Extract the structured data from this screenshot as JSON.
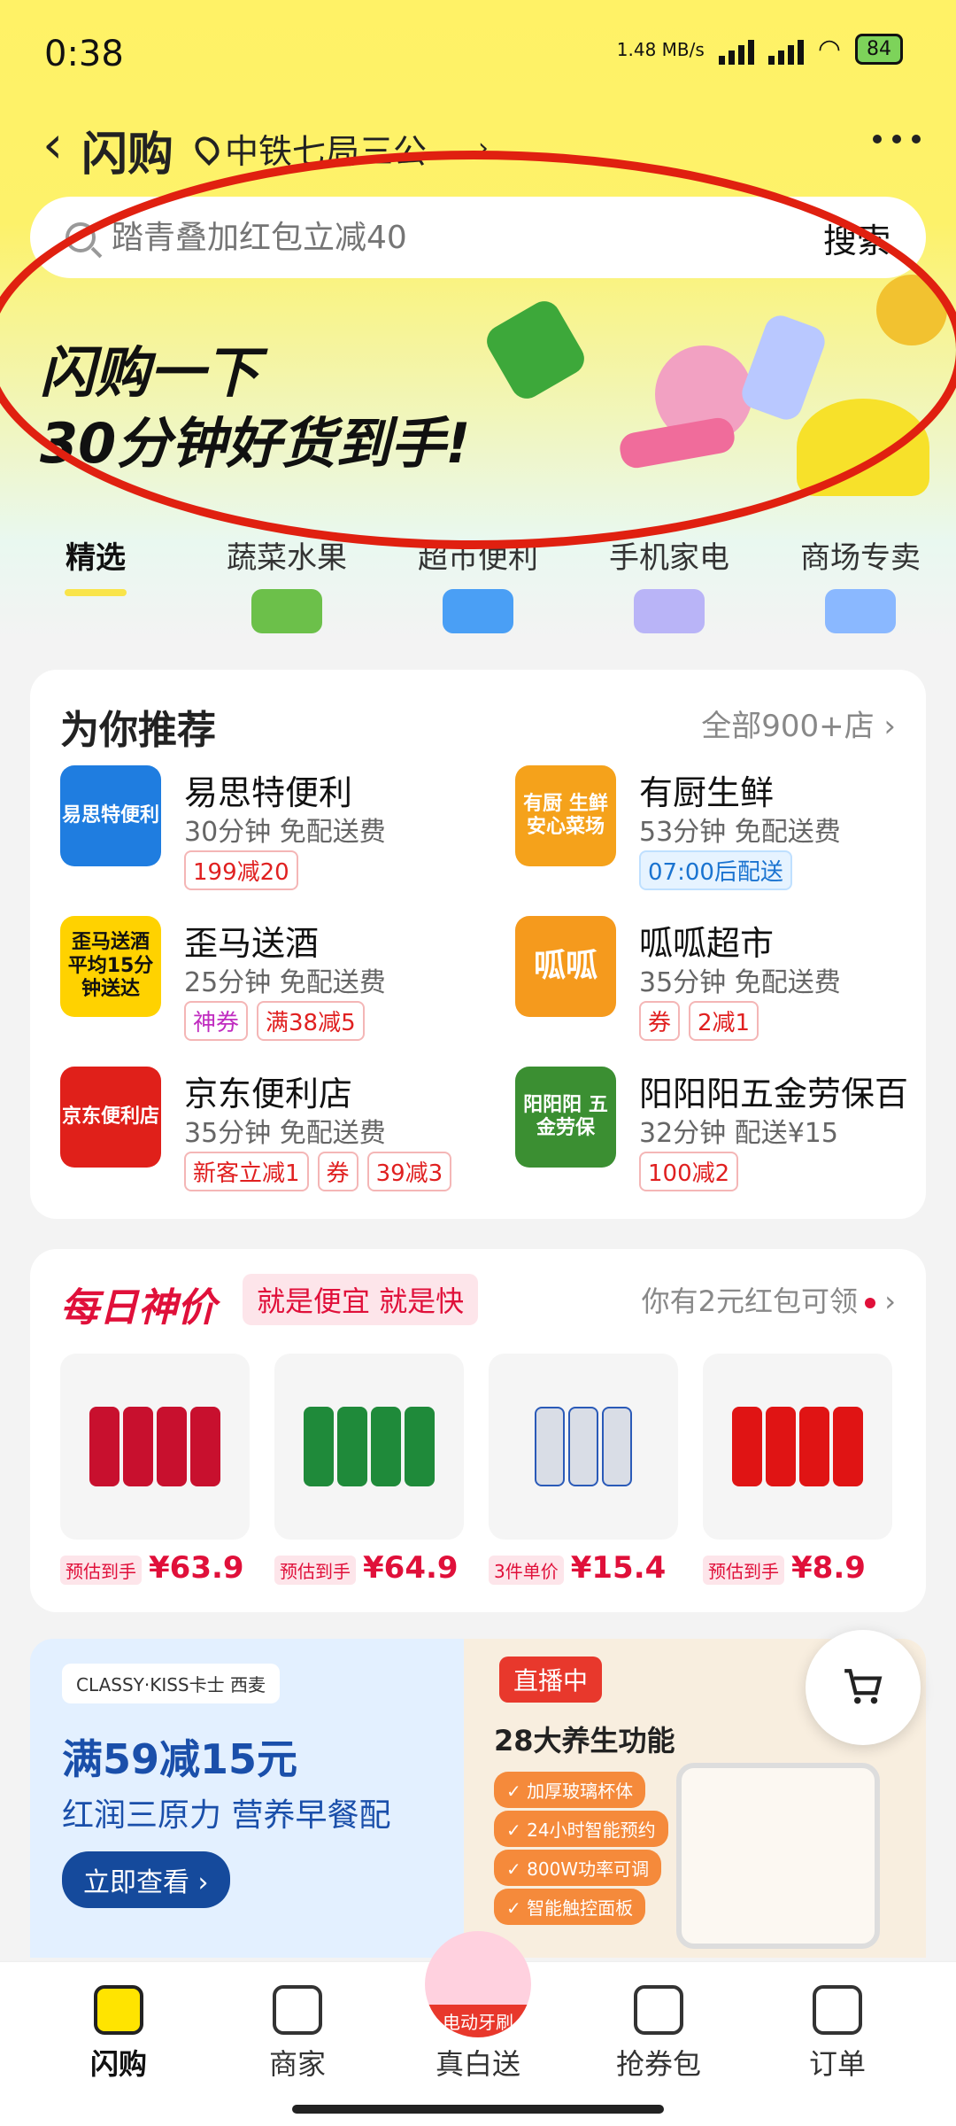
{
  "status": {
    "time": "0:38",
    "net_speed": "1.48 MB/s",
    "battery": "84"
  },
  "nav": {
    "title": "闪购",
    "location": "中铁七局三公"
  },
  "search": {
    "placeholder": "踏青叠加红包立减40",
    "button": "搜索"
  },
  "banner": {
    "line1": "闪购一下",
    "line2": "30分钟好货到手!"
  },
  "tabs": [
    "精选",
    "蔬菜水果",
    "超市便利",
    "手机家电",
    "商场专卖"
  ],
  "recommend": {
    "title": "为你推荐",
    "all": "全部900+店 ›",
    "stores": [
      {
        "name": "易思特便利",
        "info": "30分钟 免配送费",
        "tags": [
          "199减20"
        ],
        "logo_text": "易思特便利",
        "logo_color": "#1f7de0"
      },
      {
        "name": "有厨生鲜",
        "info": "53分钟 免配送费",
        "tags": [
          "07:00后配送"
        ],
        "logo_text": "有厨 生鲜 安心菜场",
        "logo_color": "#f5a21b"
      },
      {
        "name": "歪马送酒",
        "info": "25分钟 免配送费",
        "tags": [
          "神券",
          "满38减5"
        ],
        "logo_text": "歪马送酒 平均15分钟送达",
        "logo_color": "#ffd200"
      },
      {
        "name": "呱呱超市",
        "info": "35分钟 免配送费",
        "tags": [
          "券",
          "2减1"
        ],
        "logo_text": "呱呱",
        "logo_color": "#f59a1d"
      },
      {
        "name": "京东便利店",
        "info": "35分钟 免配送费",
        "tags": [
          "新客立减1",
          "券",
          "39减3"
        ],
        "logo_text": "京东便利店",
        "logo_color": "#e0201a"
      },
      {
        "name": "阳阳阳五金劳保百",
        "info": "32分钟 配送¥15",
        "tags": [
          "100减2"
        ],
        "logo_text": "阳阳阳 五金劳保",
        "logo_color": "#3b8f32"
      }
    ]
  },
  "deals": {
    "title": "每日神价",
    "subtitle": "就是便宜 就是快",
    "right": "你有2元红包可领",
    "products": [
      {
        "label": "预估到手",
        "price": "¥63.9",
        "color": "#c8102e"
      },
      {
        "label": "预估到手",
        "price": "¥64.9",
        "color": "#1f8a3a"
      },
      {
        "label": "3件单价",
        "price": "¥15.4",
        "color": "#d9dde6"
      },
      {
        "label": "预估到手",
        "price": "¥8.9",
        "color": "#e01414"
      }
    ]
  },
  "promo": {
    "brand": "CLASSY·KISS卡士 西麦",
    "title": "满59减15元",
    "subtitle": "红润三原力 营养早餐配",
    "button": "立即查看 ›"
  },
  "live": {
    "badge": "直播中",
    "title": "28大养生功能",
    "features": [
      "✓ 加厚玻璃杯体",
      "✓ 24小时智能预约",
      "✓ 800W功率可调",
      "✓ 智能触控面板"
    ]
  },
  "bottom": {
    "items": [
      "闪购",
      "商家",
      "真白送",
      "抢券包",
      "订单"
    ],
    "float_label": "电动牙刷"
  }
}
